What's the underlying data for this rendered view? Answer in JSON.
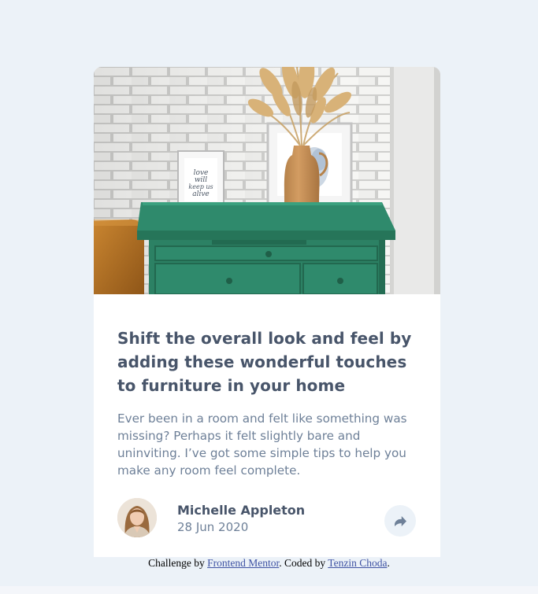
{
  "card": {
    "title": "Shift the overall look and feel by adding these wonderful touches to furniture in your home",
    "description": "Ever been in a room and felt like something was missing? Perhaps it felt slightly bare and uninviting. I’ve got some simple tips to help you make any room feel complete.",
    "frame_text": "love will keep us alive"
  },
  "author": {
    "name": "Michelle Appleton",
    "date": "28 Jun 2020"
  },
  "share": {
    "icon": "share-icon"
  },
  "attribution": {
    "prefix": "Challenge by ",
    "link1": "Frontend Mentor",
    "middle": ". Coded by ",
    "link2": "Tenzin Choda",
    "suffix": "."
  },
  "colors": {
    "page_bg": "#ecf2f8",
    "title": "#48556a",
    "text": "#6e8098",
    "link": "#3e52a3",
    "dresser": "#2f8a6c"
  }
}
